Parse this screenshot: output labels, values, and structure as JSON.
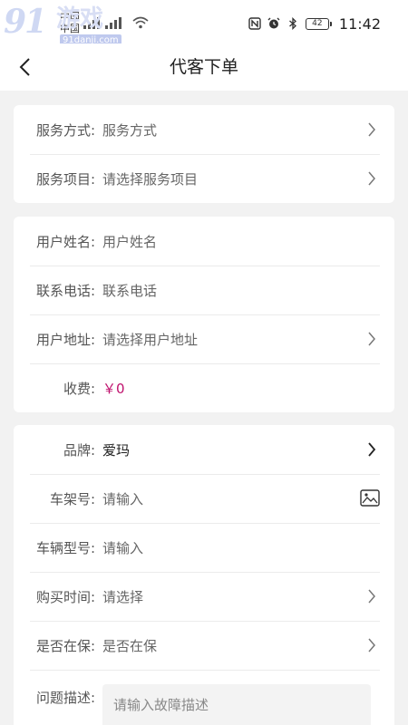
{
  "status_bar": {
    "carrier_line1": "中国",
    "carrier_line2": "中国",
    "signal_label": "4G",
    "battery": "42",
    "time": "11:42"
  },
  "watermark": {
    "logo": "91",
    "text": "游戏",
    "url": "91danji.com"
  },
  "navbar": {
    "title": "代客下单",
    "back_icon": "chevron-left-icon"
  },
  "service_card": {
    "rows": [
      {
        "label": "服务方式:",
        "value": "服务方式"
      },
      {
        "label": "服务项目:",
        "value": "请选择服务项目"
      }
    ]
  },
  "user_card": {
    "rows": [
      {
        "label": "用户姓名:",
        "value": "用户姓名"
      },
      {
        "label": "联系电话:",
        "value": "联系电话"
      },
      {
        "label": "用户地址:",
        "value": "请选择用户地址"
      },
      {
        "label": "收费:",
        "value": "￥0"
      }
    ]
  },
  "vehicle_card": {
    "rows": [
      {
        "label": "品牌:",
        "value": "爱玛"
      },
      {
        "label": "车架号:",
        "value": "请输入"
      },
      {
        "label": "车辆型号:",
        "value": "请输入"
      },
      {
        "label": "购买时间:",
        "value": "请选择"
      },
      {
        "label": "是否在保:",
        "value": "是否在保"
      }
    ],
    "description": {
      "label": "问题描述:",
      "placeholder": "请输入故障描述"
    }
  },
  "colors": {
    "accent_price": "#c0126e",
    "background": "#f2f2f2",
    "card": "#ffffff"
  }
}
